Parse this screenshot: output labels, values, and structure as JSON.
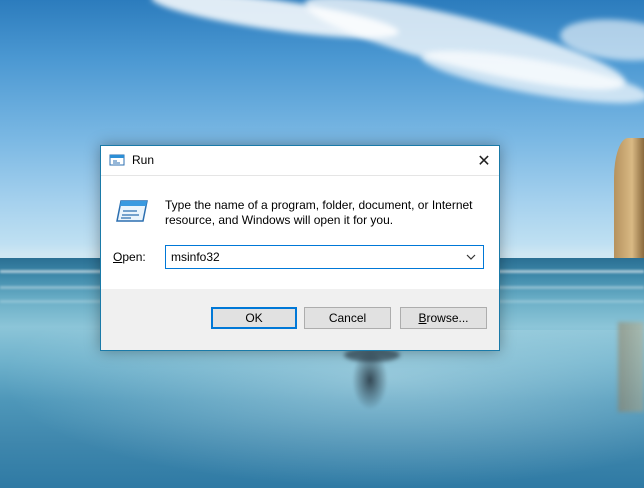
{
  "dialog": {
    "title": "Run",
    "description": "Type the name of a program, folder, document, or Internet resource, and Windows will open it for you.",
    "open_label_prefix": "",
    "open_label_underlined": "O",
    "open_label_rest": "pen:",
    "input_value": "msinfo32",
    "buttons": {
      "ok": "OK",
      "cancel": "Cancel",
      "browse_underlined": "B",
      "browse_rest": "rowse..."
    },
    "close_glyph": "✕",
    "dropdown_glyph": "⌵"
  },
  "icons": {
    "title": "run-icon",
    "body": "run-icon",
    "close": "close-icon",
    "dropdown": "chevron-down-icon"
  },
  "colors": {
    "accent": "#0078d7",
    "dialog_border": "#1a7aa8",
    "button_face": "#e1e1e1"
  }
}
